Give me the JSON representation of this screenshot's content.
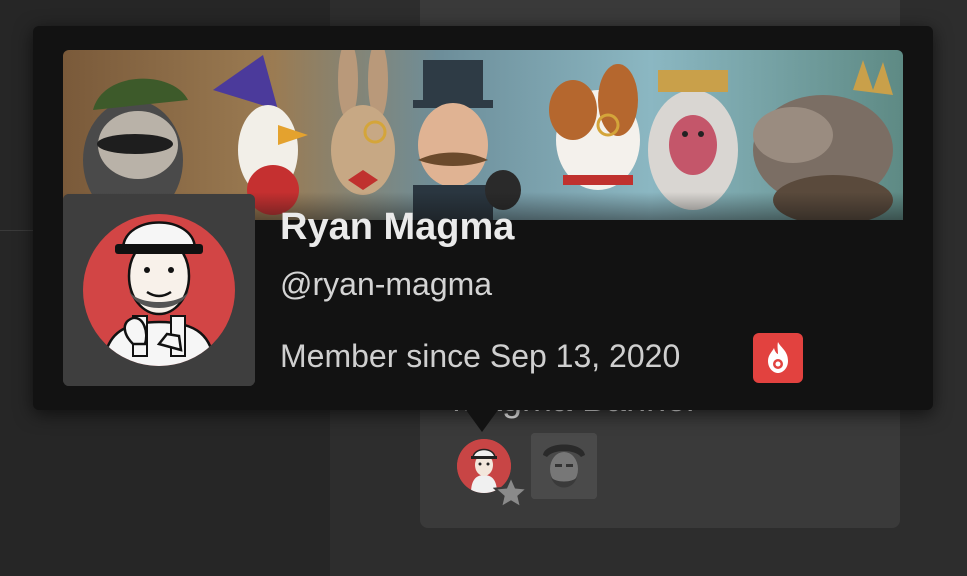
{
  "profile": {
    "name": "Ryan Magma",
    "handle": "@ryan-magma",
    "member_since": "Member since Sep 13, 2020",
    "badge_icon": "hot-flame-icon",
    "badge_color": "#e2423f",
    "avatar_bg": "#d24545"
  },
  "card": {
    "title": "Magma Banner"
  },
  "colors": {
    "popover_bg": "#121212",
    "page_bg": "#262626",
    "card_bg": "#3a3a3a"
  }
}
